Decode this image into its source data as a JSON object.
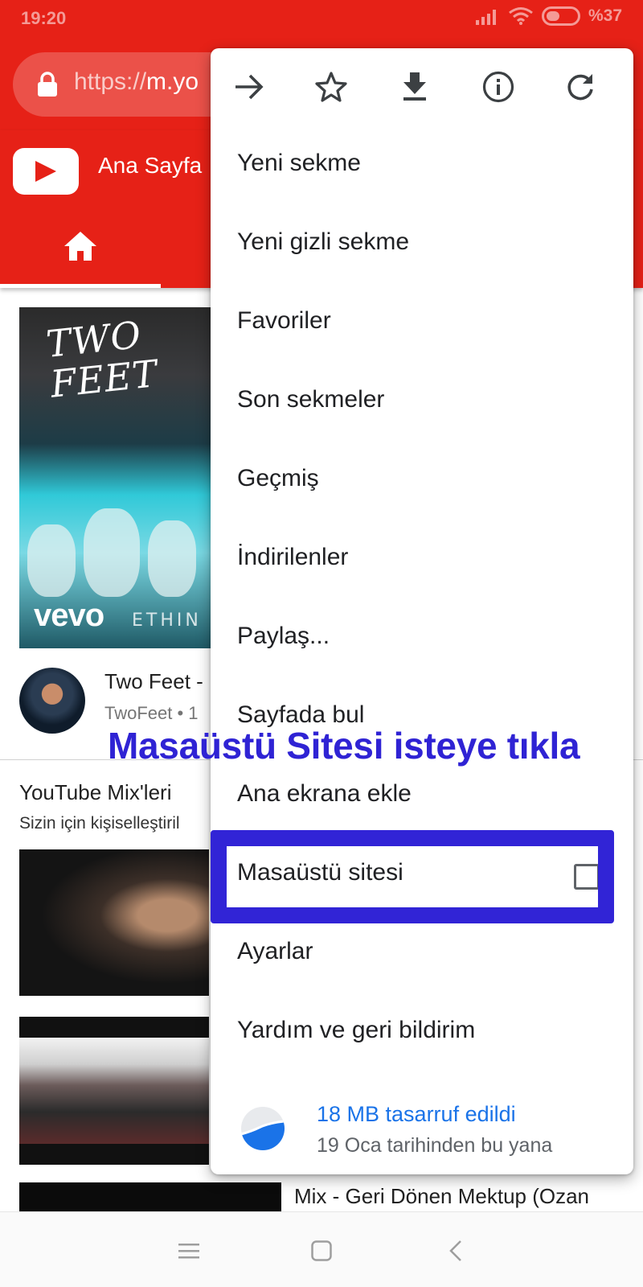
{
  "status_bar": {
    "time": "19:20",
    "battery_text": "%37"
  },
  "browser": {
    "url_prefix": "https://",
    "url_host": "m.yo"
  },
  "youtube": {
    "header_title": "Ana Sayfa",
    "feed": {
      "featured": {
        "thumb_art_text": "TWO\nFEET",
        "thumb_brand": "vevo",
        "thumb_caption": "ETHIN",
        "title": "Two Feet -",
        "channel": "TwoFeet • 1"
      },
      "mix_section": {
        "title": "YouTube Mix'leri",
        "subtitle": "Sizin için kişiselleştiril",
        "third_item_title": "Mix - Geri Dönen Mektup (Ozan"
      }
    }
  },
  "menu": {
    "icons": [
      "forward-icon",
      "bookmark-star-icon",
      "download-icon",
      "info-icon",
      "reload-icon"
    ],
    "items": [
      {
        "label": "Yeni sekme"
      },
      {
        "label": "Yeni gizli sekme"
      },
      {
        "label": "Favoriler"
      },
      {
        "label": "Son sekmeler"
      },
      {
        "label": "Geçmiş"
      },
      {
        "label": "İndirilenler"
      },
      {
        "label": "Paylaş..."
      },
      {
        "label": "Sayfada bul"
      },
      {
        "label": "Ana ekrana ekle"
      },
      {
        "label": "Masaüstü sitesi",
        "checked": false
      },
      {
        "label": "Ayarlar"
      },
      {
        "label": "Yardım ve geri bildirim"
      }
    ],
    "data_saver": {
      "main": "18 MB tasarruf edildi",
      "sub": "19 Oca tarihinden bu yana"
    }
  },
  "annotation": {
    "instruction": "Masaüstü Sitesi isteye tıkla",
    "highlight_color": "#3124d6"
  },
  "colors": {
    "youtube_red": "#e62117",
    "link_blue": "#1a73e8"
  }
}
